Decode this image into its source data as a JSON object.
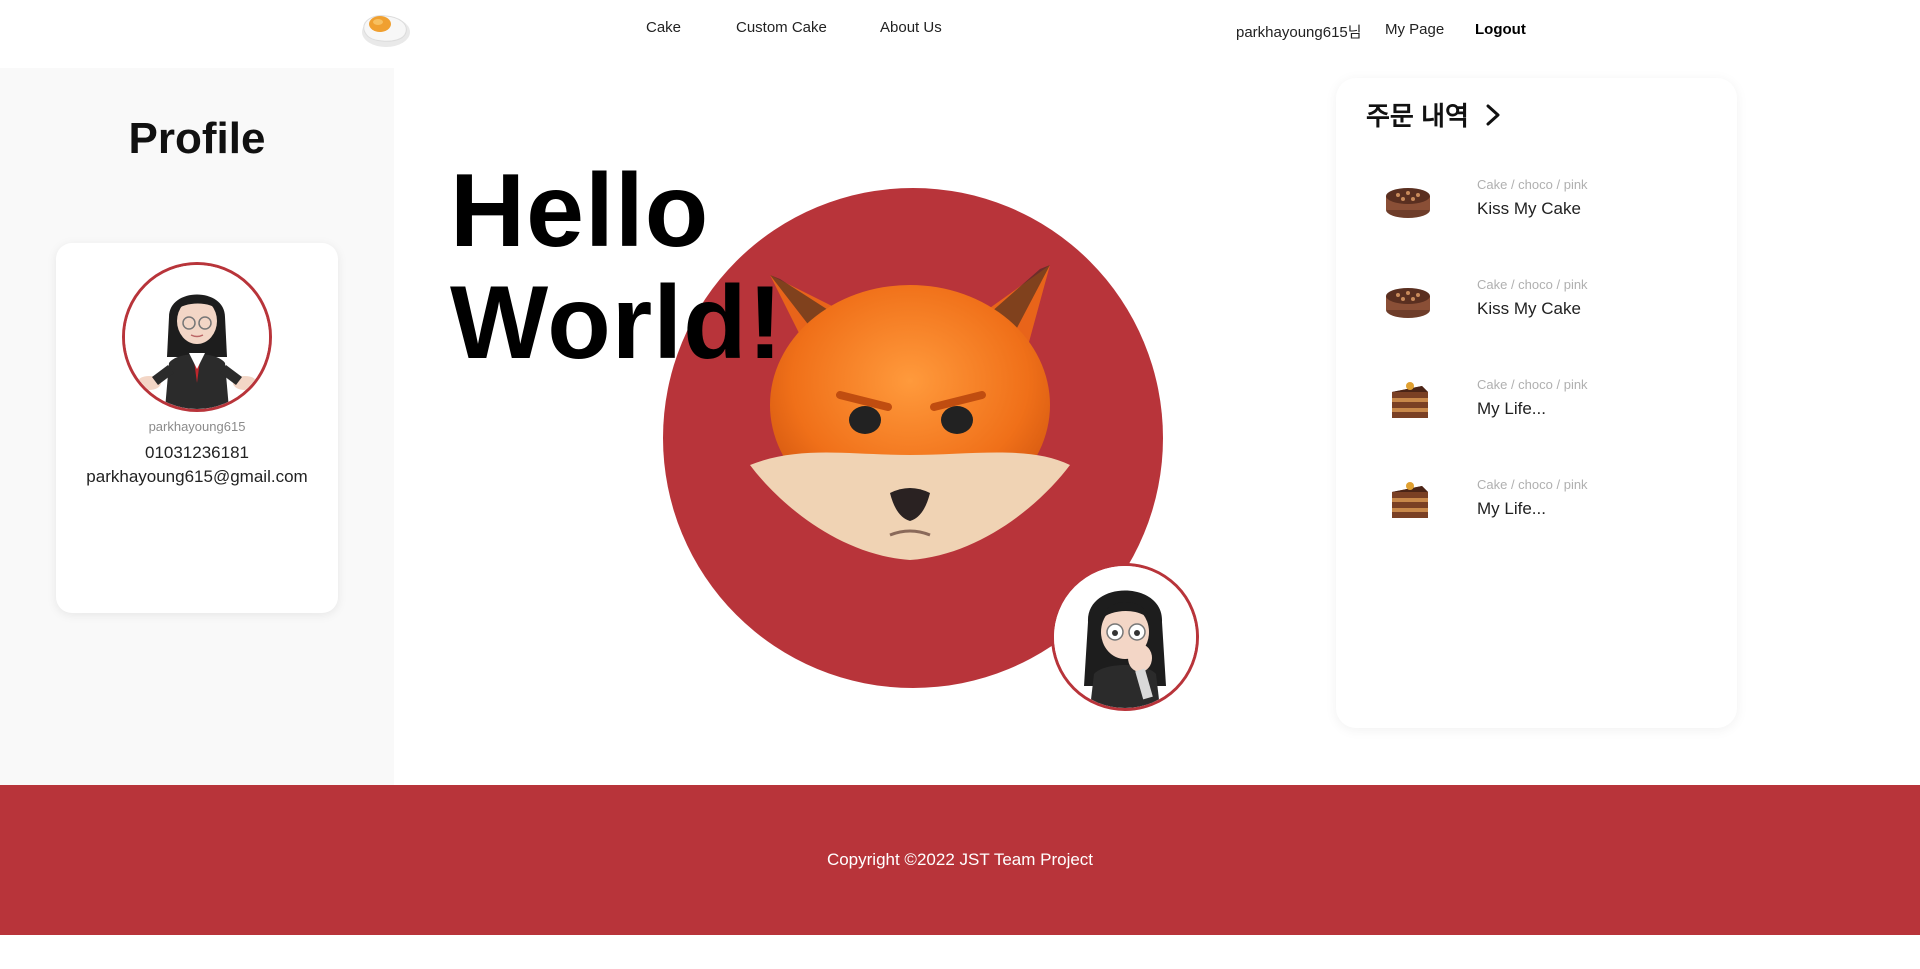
{
  "header": {
    "nav": [
      "Cake",
      "Custom Cake",
      "About Us"
    ],
    "user_greeting": "parkhayoung615님",
    "my_page": "My Page",
    "logout": "Logout"
  },
  "profile": {
    "title": "Profile",
    "username": "parkhayoung615",
    "phone": "01031236181",
    "email": "parkhayoung615@gmail.com"
  },
  "hero": {
    "line1": "Hello",
    "line2": "World!"
  },
  "orders": {
    "title": "주문 내역",
    "items": [
      {
        "category": "Cake / choco / pink",
        "name": "Kiss My Cake",
        "thumb": "round-cake"
      },
      {
        "category": "Cake / choco / pink",
        "name": "Kiss My Cake",
        "thumb": "round-cake"
      },
      {
        "category": "Cake / choco / pink",
        "name": "My Life...",
        "thumb": "slice-cake"
      },
      {
        "category": "Cake / choco / pink",
        "name": "My Life...",
        "thumb": "slice-cake"
      }
    ]
  },
  "footer": {
    "copyright": "Copyright ©2022 JST Team Project"
  },
  "colors": {
    "accent": "#b8343a",
    "panel_bg": "#f9f9f9"
  }
}
